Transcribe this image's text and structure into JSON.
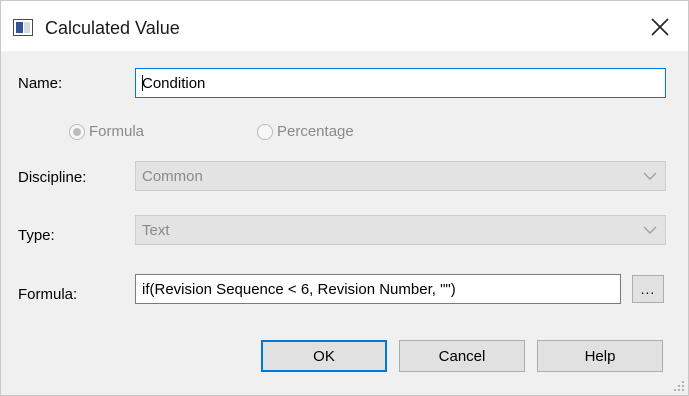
{
  "window": {
    "title": "Calculated Value"
  },
  "form": {
    "name": {
      "label": "Name:",
      "value": "Condition"
    },
    "mode": {
      "option_formula": "Formula",
      "option_percentage": "Percentage",
      "selected": "Formula"
    },
    "discipline": {
      "label": "Discipline:",
      "value": "Common"
    },
    "type": {
      "label": "Type:",
      "value": "Text"
    },
    "formula": {
      "label": "Formula:",
      "value": "if(Revision Sequence < 6, Revision Number, \"\")",
      "browse_label": "..."
    }
  },
  "buttons": {
    "ok": "OK",
    "cancel": "Cancel",
    "help": "Help"
  },
  "colors": {
    "accent": "#0078d7",
    "dialog_bg": "#f0f0f0",
    "disabled_text": "#8a8a8a"
  }
}
